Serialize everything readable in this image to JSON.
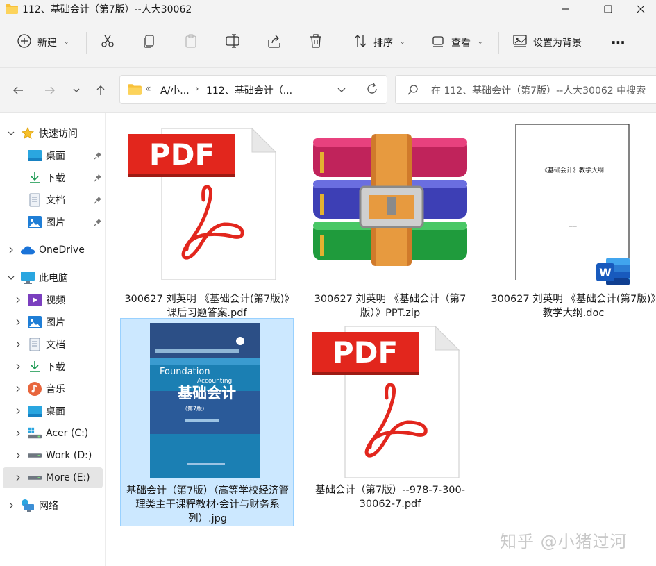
{
  "window": {
    "title": "112、基础会计（第7版）--人大30062"
  },
  "toolbar": {
    "new_label": "新建",
    "sort_label": "排序",
    "view_label": "查看",
    "set_background_label": "设置为背景",
    "more_label": "···"
  },
  "address": {
    "back_glyph": "«",
    "segment1": "A/小...",
    "segment2": "112、基础会计（...",
    "separator": "›"
  },
  "search": {
    "placeholder": "在 112、基础会计（第7版）--人大30062 中搜索"
  },
  "sidebar": {
    "quick_access": "快速访问",
    "quick_items": [
      "桌面",
      "下载",
      "文档",
      "图片"
    ],
    "onedrive": "OneDrive",
    "this_pc": "此电脑",
    "pc_items": [
      "视频",
      "图片",
      "文档",
      "下载",
      "音乐",
      "桌面",
      "Acer (C:)",
      "Work (D:)",
      "More (E:)"
    ],
    "network": "网络"
  },
  "files": [
    {
      "name": "300627 刘英明 《基础会计(第7版)》课后习题答案.pdf",
      "type": "pdf",
      "badge": "PDF"
    },
    {
      "name": "300627 刘英明 《基础会计（第7版）》PPT.zip",
      "type": "zip"
    },
    {
      "name": "300627 刘英明 《基础会计(第7版)》教学大纲.doc",
      "type": "doc",
      "doc_title": "《基础会计》教学大纲",
      "doc_footer": "——"
    },
    {
      "name": "基础会计（第7版）（高等学校经济管理类主干课程教材·会计与财务系列）.jpg",
      "type": "jpg",
      "selected": true,
      "cover_en1": "Foundation",
      "cover_en2": "Accounting",
      "cover_title": "基础会计",
      "cover_edition": "（第7版）"
    },
    {
      "name": "基础会计（第7版）--978-7-300-30062-7.pdf",
      "type": "pdf",
      "badge": "PDF"
    }
  ],
  "watermark": "知乎 @小猪过河",
  "colors": {
    "accent": "#0067c0",
    "pdf_red": "#e2261d",
    "selection": "#cce8ff",
    "word_blue": "#185abd"
  }
}
